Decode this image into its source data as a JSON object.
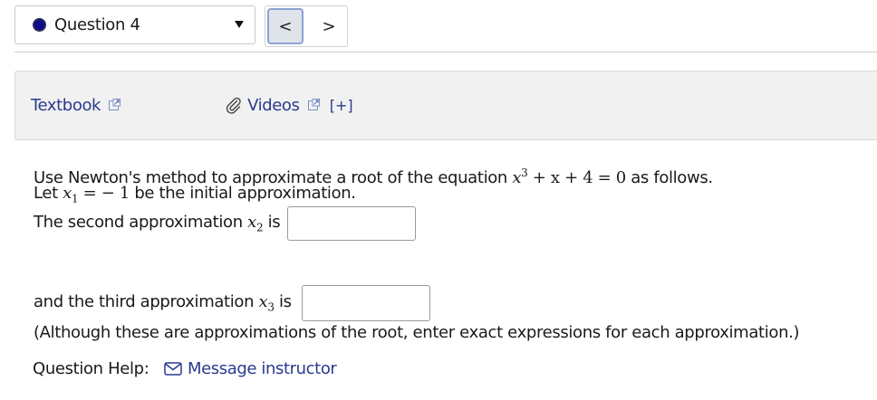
{
  "question_selector": {
    "status_color": "#0d0d8a",
    "label": "Question 4"
  },
  "nav": {
    "prev_label": "<",
    "next_label": ">"
  },
  "resources": {
    "textbook_label": "Textbook",
    "videos_label": "Videos",
    "expand_label": "[+]",
    "link_color": "#2a3a8f"
  },
  "question": {
    "line1_prefix": "Use Newton's method to approximate a root of the equation ",
    "equation": {
      "var": "x",
      "exp": "3",
      "rest": " + x + 4 = 0"
    },
    "line1_suffix": " as follows.",
    "line2_prefix": "Let ",
    "x1_var": "x",
    "x1_sub": "1",
    "x1_value": " =  − 1",
    "line2_suffix": " be the initial approximation.",
    "second_prefix": "The second approximation ",
    "x2_var": "x",
    "x2_sub": "2",
    "second_suffix": " is",
    "second_answer": "",
    "third_prefix": "and the third approximation ",
    "x3_var": "x",
    "x3_sub": "3",
    "third_suffix": " is",
    "third_answer": "",
    "note": "(Although these are approximations of the root, enter exact expressions for each approximation.)"
  },
  "help": {
    "label": "Question Help:",
    "message_label": "Message instructor"
  }
}
